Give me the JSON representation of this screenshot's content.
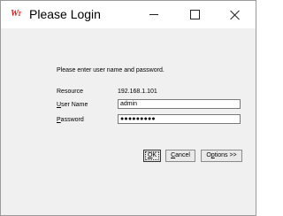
{
  "window": {
    "title": "Please Login",
    "app_icon_text": "W",
    "app_icon_sub": "T"
  },
  "form": {
    "prompt": "Please enter user name and password.",
    "resource_label": "Resource",
    "resource_value": "192.168.1.101",
    "username_label_ul": "U",
    "username_label_rest": "ser Name",
    "username_value": "admin",
    "password_label_ul": "P",
    "password_label_rest": "assword",
    "password_value": "●●●●●●●●●"
  },
  "buttons": {
    "ok_ul": "O",
    "ok_rest": "K",
    "cancel_ul": "C",
    "cancel_rest": "ancel",
    "options_pre": "O",
    "options_ul": "p",
    "options_rest": "tions >>"
  }
}
